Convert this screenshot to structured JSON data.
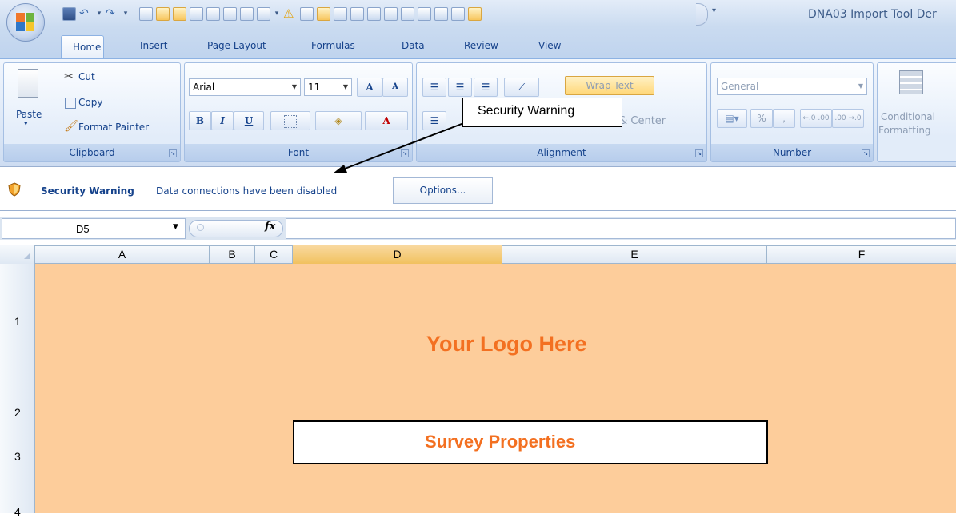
{
  "window": {
    "title": "DNA03 Import Tool Der"
  },
  "tabs": [
    "Home",
    "Insert",
    "Page Layout",
    "Formulas",
    "Data",
    "Review",
    "View"
  ],
  "clipboard": {
    "paste": "Paste",
    "cut": "Cut",
    "copy": "Copy",
    "format_painter": "Format Painter",
    "group": "Clipboard"
  },
  "font": {
    "name": "Arial",
    "size": "11",
    "group": "Font",
    "bold": "B",
    "italic": "I",
    "underline": "U",
    "grow": "A",
    "shrink": "A",
    "color": "A"
  },
  "alignment": {
    "wrap_text": "Wrap Text",
    "merge_center": "e & Center",
    "group": "Alignment"
  },
  "number": {
    "format": "General",
    "percent": "%",
    "comma": ",",
    "group": "Number",
    "inc_decimal": "←.0 .00",
    "dec_decimal": ".00 →.0"
  },
  "styles": {
    "conditional": "Conditional",
    "formatting": "Formatting"
  },
  "security": {
    "title": "Security Warning",
    "message": "Data connections have been disabled",
    "options": "Options..."
  },
  "callout": {
    "text": "Security Warning"
  },
  "formula_bar": {
    "name_box": "D5",
    "fx": "fx",
    "formula": ""
  },
  "columns": [
    "A",
    "B",
    "C",
    "D",
    "E",
    "F"
  ],
  "selected_column": "D",
  "rows": [
    "1",
    "2",
    "3",
    "4"
  ],
  "sheet": {
    "logo_text": "Your Logo Here",
    "survey_title": "Survey Properties"
  },
  "colors": {
    "sheet_fill": "#fdcd9b",
    "accent_text": "#f37021",
    "ribbon_text": "#15428b"
  }
}
